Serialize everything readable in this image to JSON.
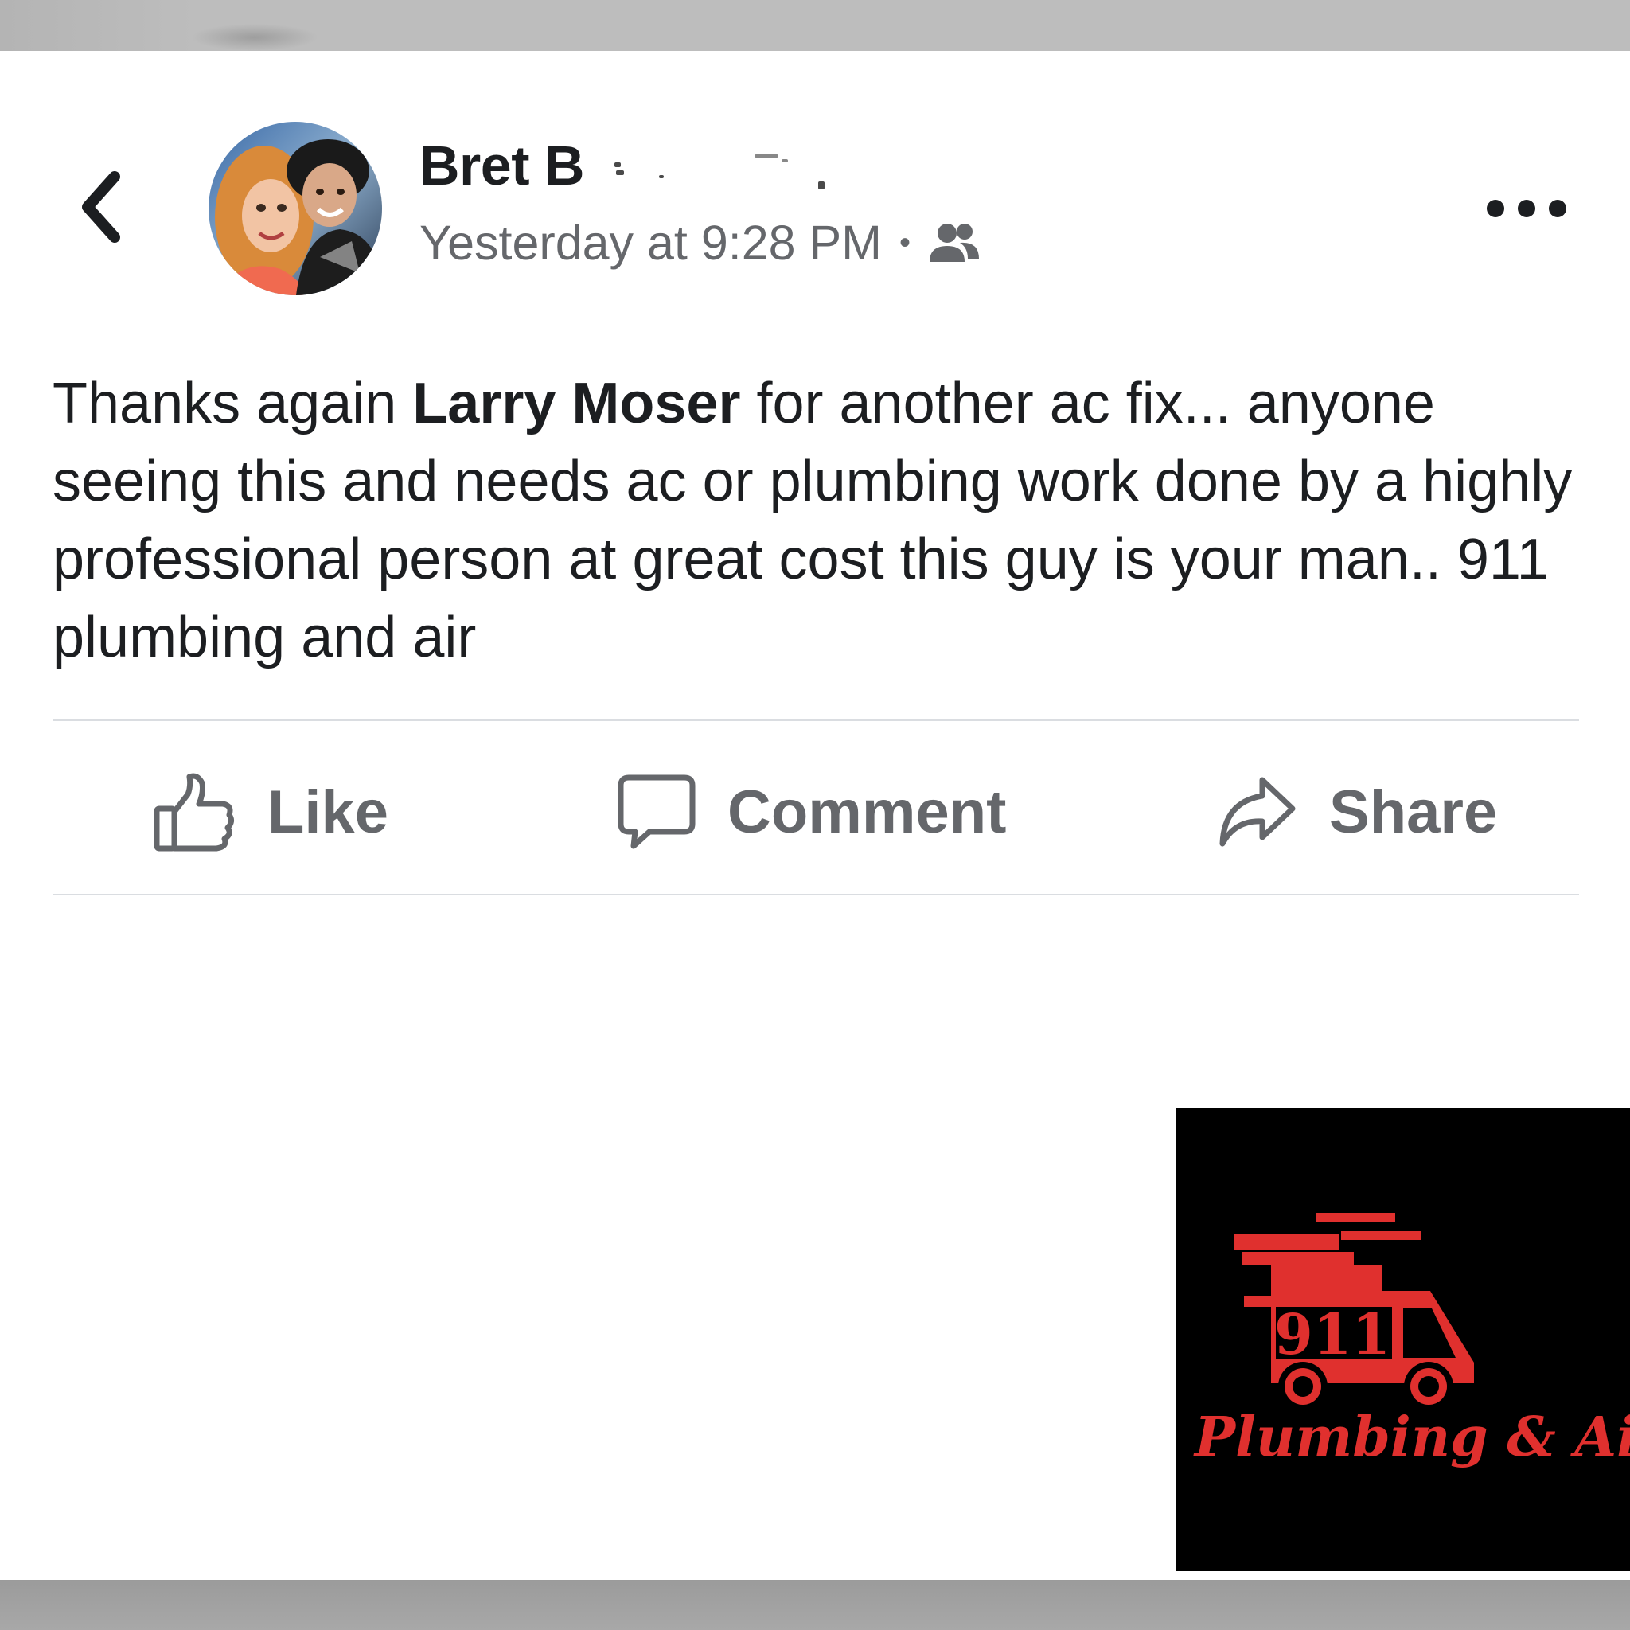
{
  "post": {
    "author": "Bret B",
    "timestamp": "Yesterday at 9:28 PM",
    "text_before": "Thanks again ",
    "mention": "Larry Moser",
    "text_after": " for another ac fix... anyone seeing this and needs ac or plumbing work done by a highly professional person at great cost this guy is your man.. 911 plumbing and air"
  },
  "actions": {
    "like": "Like",
    "comment": "Comment",
    "share": "Share"
  },
  "logo": {
    "number": "911",
    "tagline": "Plumbing & Air"
  },
  "colors": {
    "logo_red": "#e0302e",
    "logo_background": "#000000",
    "secondary_text": "#65676b",
    "divider": "#dadde1"
  },
  "icons": {
    "back": "chevron-left-icon",
    "audience": "friends-icon",
    "more": "more-dots-icon",
    "like": "thumbs-up-icon",
    "comment": "speech-bubble-icon",
    "share": "share-arrow-icon"
  }
}
